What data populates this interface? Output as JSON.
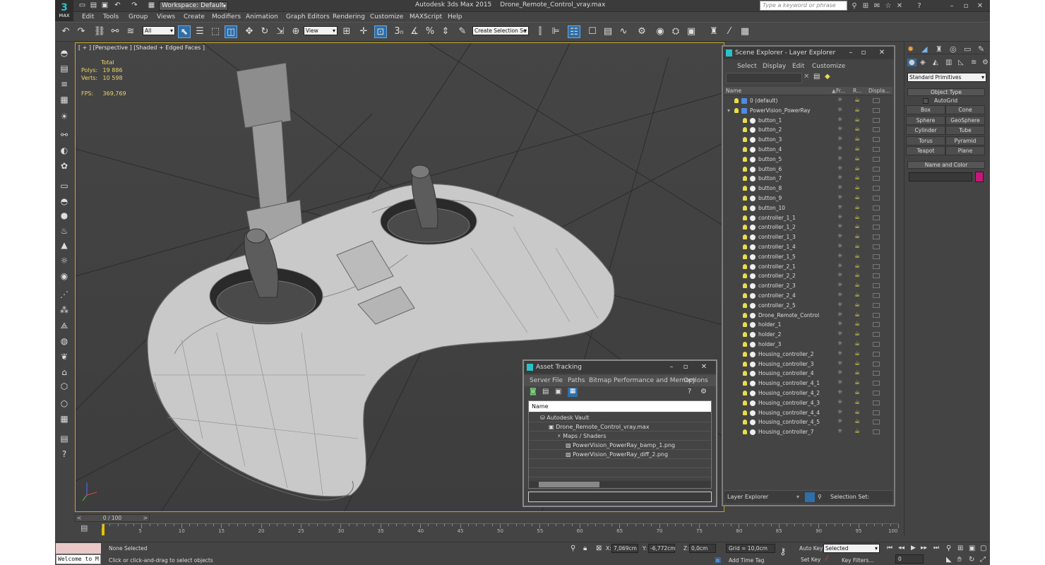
{
  "app": {
    "logo": "3",
    "logo_sub": "MAX",
    "workspace": "Workspace: Default",
    "title": "Autodesk 3ds Max  2015",
    "file": "Drone_Remote_Control_vray.max",
    "search_placeholder": "Type a keyword or phrase"
  },
  "menu": [
    "Edit",
    "Tools",
    "Group",
    "Views",
    "Create",
    "Modifiers",
    "Animation",
    "Graph Editors",
    "Rendering",
    "Customize",
    "MAXScript",
    "Help"
  ],
  "toolbar": {
    "selection_filter": "All",
    "ref_coord": "View",
    "named_selection": "Create Selection Se",
    "snap_labels": [
      "3",
      "n"
    ]
  },
  "viewport": {
    "label": "[ + ] [Perspective ] [Shaded + Edged Faces ]",
    "stats_header": "Total",
    "polys_label": "Polys:",
    "polys": "19 886",
    "verts_label": "Verts:",
    "verts": "10 598",
    "fps_label": "FPS:",
    "fps": "369,769"
  },
  "scene_explorer": {
    "title": "Scene Explorer - Layer Explorer",
    "menu": [
      "Select",
      "Display",
      "Edit",
      "Customize"
    ],
    "columns": [
      "Name",
      "Fr...",
      "R...",
      "Displa..."
    ],
    "rows": [
      {
        "name": "0 (default)",
        "level": 0
      },
      {
        "name": "PowerVision_PowerRay",
        "level": 0
      },
      {
        "name": "button_1",
        "level": 1
      },
      {
        "name": "button_2",
        "level": 1
      },
      {
        "name": "button_3",
        "level": 1
      },
      {
        "name": "button_4",
        "level": 1
      },
      {
        "name": "button_5",
        "level": 1
      },
      {
        "name": "button_6",
        "level": 1
      },
      {
        "name": "button_7",
        "level": 1
      },
      {
        "name": "button_8",
        "level": 1
      },
      {
        "name": "button_9",
        "level": 1
      },
      {
        "name": "button_10",
        "level": 1
      },
      {
        "name": "controller_1_1",
        "level": 1
      },
      {
        "name": "controller_1_2",
        "level": 1
      },
      {
        "name": "controller_1_3",
        "level": 1
      },
      {
        "name": "controller_1_4",
        "level": 1
      },
      {
        "name": "controller_1_5",
        "level": 1
      },
      {
        "name": "controller_2_1",
        "level": 1
      },
      {
        "name": "controller_2_2",
        "level": 1
      },
      {
        "name": "controller_2_3",
        "level": 1
      },
      {
        "name": "controller_2_4",
        "level": 1
      },
      {
        "name": "controller_2_5",
        "level": 1
      },
      {
        "name": "Drone_Remote_Control",
        "level": 1
      },
      {
        "name": "holder_1",
        "level": 1
      },
      {
        "name": "holder_2",
        "level": 1
      },
      {
        "name": "holder_3",
        "level": 1
      },
      {
        "name": "Housing_controller_2",
        "level": 1
      },
      {
        "name": "Housing_controller_3",
        "level": 1
      },
      {
        "name": "Housing_controller_4",
        "level": 1
      },
      {
        "name": "Housing_controller_4_1",
        "level": 1
      },
      {
        "name": "Housing_controller_4_2",
        "level": 1
      },
      {
        "name": "Housing_controller_4_3",
        "level": 1
      },
      {
        "name": "Housing_controller_4_4",
        "level": 1
      },
      {
        "name": "Housing_controller_4_5",
        "level": 1
      },
      {
        "name": "Housing_controller_7",
        "level": 1
      }
    ],
    "footer_left": "Layer Explorer",
    "footer_right": "Selection Set:"
  },
  "asset_tracking": {
    "title": "Asset Tracking",
    "menu": [
      "Server",
      "File",
      "Paths",
      "Bitmap Performance and Memory",
      "Options"
    ],
    "column": "Name",
    "items": [
      {
        "name": "Autodesk Vault",
        "level": 0
      },
      {
        "name": "Drone_Remote_Control_vray.max",
        "level": 1
      },
      {
        "name": "Maps / Shaders",
        "level": 2
      },
      {
        "name": "PowerVision_PowerRay_bamp_1.png",
        "level": 3
      },
      {
        "name": "PowerVision_PowerRay_diff_2.png",
        "level": 3
      }
    ]
  },
  "command_panel": {
    "category": "Standard Primitives",
    "object_type": "Object Type",
    "autogrid": "AutoGrid",
    "buttons": [
      "Box",
      "Cone",
      "Sphere",
      "GeoSphere",
      "Cylinder",
      "Tube",
      "Torus",
      "Pyramid",
      "Teapot",
      "Plane"
    ],
    "name_and_color": "Name and Color",
    "object_color": "#c8177a"
  },
  "timeline": {
    "slider": "0 / 100",
    "ticks": [
      "5",
      "10",
      "15",
      "20",
      "25",
      "30",
      "35",
      "40",
      "45",
      "50",
      "55",
      "60",
      "65",
      "70",
      "75",
      "80",
      "85",
      "90",
      "95",
      "100"
    ]
  },
  "status": {
    "welcome": "Welcome to M",
    "selected": "None Selected",
    "prompt": "Click or click-and-drag to select objects",
    "x_label": "X:",
    "x": "7,069cm",
    "y_label": "Y:",
    "y": "-6,772cm",
    "z_label": "Z:",
    "z": "0,0cm",
    "grid": "Grid = 10,0cm",
    "add_time_tag": "Add Time Tag",
    "auto_key": "Auto Key",
    "set_key": "Set Key",
    "selected_dd": "Selected",
    "key_filters": "Key Filters...",
    "frame": "0"
  }
}
